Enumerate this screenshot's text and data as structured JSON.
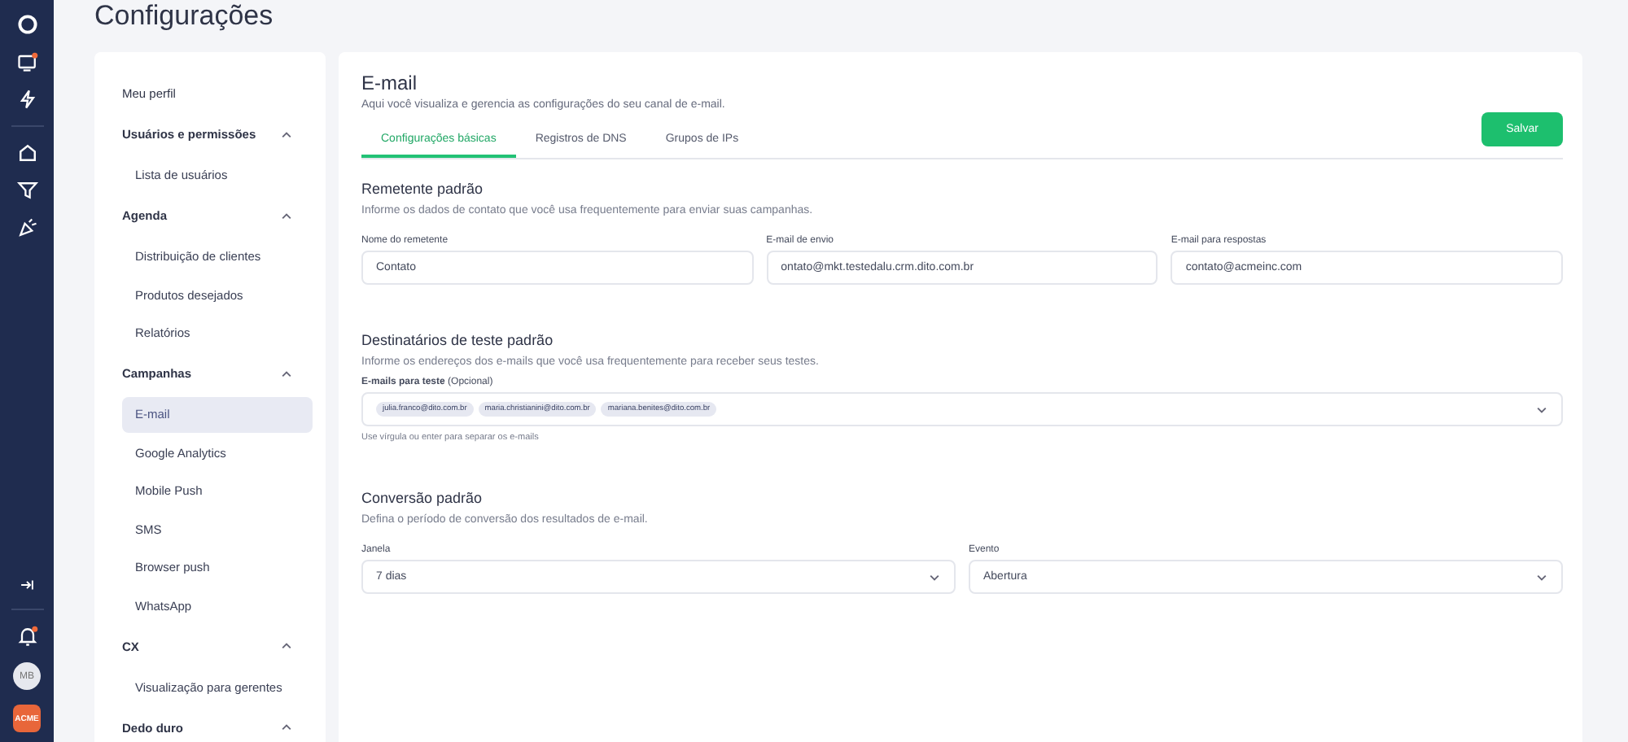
{
  "page_title": "Configurações",
  "rail": {
    "avatar": "MB",
    "logo": "ACME",
    "notifications_badge": true
  },
  "nav": [
    {
      "kind": "item",
      "label": "Meu perfil",
      "selected": false
    },
    {
      "kind": "group",
      "label": "Usuários e permissões",
      "expanded": true,
      "children": [
        {
          "label": "Lista de usuários",
          "selected": false
        }
      ]
    },
    {
      "kind": "group",
      "label": "Agenda",
      "expanded": true,
      "children": [
        {
          "label": "Distribuição de clientes",
          "selected": false
        },
        {
          "label": "Produtos desejados",
          "selected": false
        },
        {
          "label": "Relatórios",
          "selected": false
        }
      ]
    },
    {
      "kind": "group",
      "label": "Campanhas",
      "expanded": true,
      "children": [
        {
          "label": "E-mail",
          "selected": true
        },
        {
          "label": "Google Analytics",
          "selected": false
        },
        {
          "label": "Mobile Push",
          "selected": false
        },
        {
          "label": "SMS",
          "selected": false
        },
        {
          "label": "Browser push",
          "selected": false
        },
        {
          "label": "WhatsApp",
          "selected": false
        }
      ]
    },
    {
      "kind": "group",
      "label": "CX",
      "expanded": true,
      "children": [
        {
          "label": "Visualização para gerentes",
          "selected": false
        }
      ]
    },
    {
      "kind": "group",
      "label": "Dedo duro",
      "expanded": true
    }
  ],
  "card": {
    "title": "E-mail",
    "subtitle": "Aqui você visualiza e gerencia as configurações do seu canal de e-mail.",
    "tabs": [
      {
        "label": "Configurações básicas",
        "selected": true
      },
      {
        "label": "Registros de DNS",
        "selected": false
      },
      {
        "label": "Grupos de IPs",
        "selected": false
      }
    ],
    "save_button": "Salvar",
    "sections": [
      {
        "kind": "fields",
        "title": "Remetente padrão",
        "description": "Informe os dados de contato que você usa frequentemente para enviar suas campanhas.",
        "fields": [
          {
            "label": "Nome do remetente",
            "value": "Contato"
          },
          {
            "label": "E-mail de envio",
            "value": "ontato@mkt.testedalu.crm.dito.com.br"
          },
          {
            "label": "E-mail para respostas",
            "value": "contato@acmeinc.com"
          }
        ]
      },
      {
        "kind": "tags",
        "title": "Destinatários de teste padrão",
        "description": "Informe os endereços dos e-mails que você usa frequentemente para receber seus testes.",
        "label": "E-mails para teste",
        "label_note": "(Opcional)",
        "tags": [
          "julia.franco@dito.com.br",
          "maria.christianini@dito.com.br",
          "mariana.benites@dito.com.br"
        ],
        "hint": "Use vírgula ou enter para separar os e-mails"
      },
      {
        "kind": "selects",
        "title": "Conversão padrão",
        "description": "Defina o período de conversão dos resultados de e-mail.",
        "fields": [
          {
            "label": "Janela",
            "value": "7 dias"
          },
          {
            "label": "Evento",
            "value": "Abertura"
          }
        ]
      }
    ]
  }
}
